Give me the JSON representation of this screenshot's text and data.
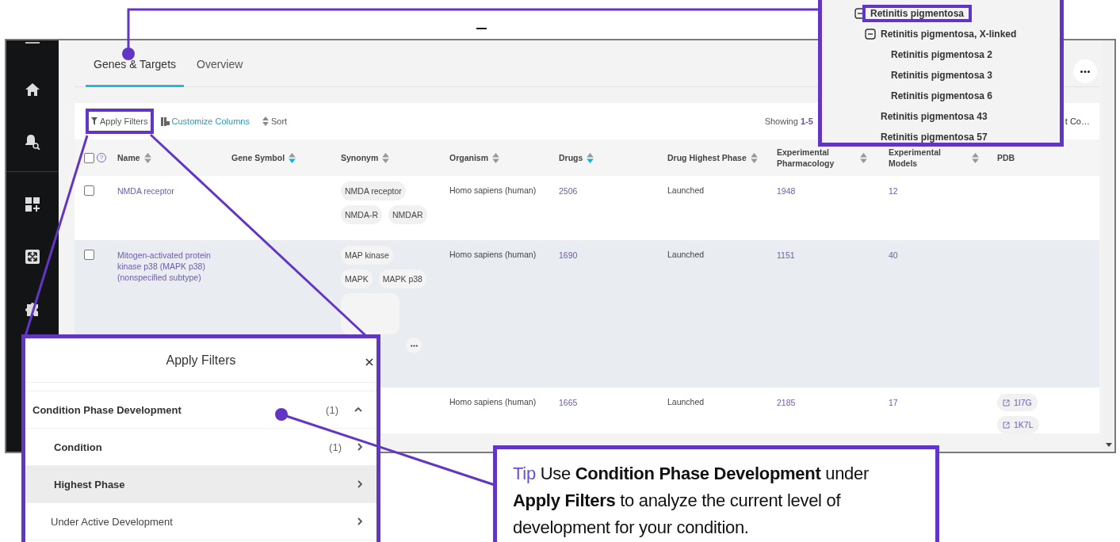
{
  "tabs": [
    {
      "label": "Genes & Targets",
      "selected": true
    },
    {
      "label": "Overview",
      "selected": false
    }
  ],
  "toolbar": {
    "buttons": [
      {
        "kind": "filter",
        "label": "Apply Filters",
        "highlighted": true
      },
      {
        "kind": "columns",
        "label": "Customize Columns",
        "highlighted": false
      },
      {
        "kind": "sort",
        "label": "Sort",
        "highlighted": false
      }
    ],
    "showing_label": "Showing",
    "showing_range": "1-5",
    "columns_button": "t Co…"
  },
  "table": {
    "all_checked": false,
    "help_mark": "?",
    "columns": [
      {
        "label": "Name",
        "sortable": true,
        "sorted": false
      },
      {
        "label": "Gene Symbol",
        "sortable": true,
        "sorted": true
      },
      {
        "label": "Synonym",
        "sortable": true,
        "sorted": false
      },
      {
        "label": "Organism",
        "sortable": true,
        "sorted": false
      },
      {
        "label": "Drugs",
        "sortable": true,
        "sorted": true
      },
      {
        "label": "Drug Highest Phase",
        "sortable": true,
        "sorted": false
      },
      {
        "label": "Experimental Pharmacology",
        "sortable": true,
        "sorted": false
      },
      {
        "label": "Experimental Models",
        "sortable": true,
        "sorted": false
      },
      {
        "label": "PDB"
      }
    ],
    "rows": [
      {
        "checked": false,
        "highlighted": false,
        "name": "NMDA receptor",
        "synonyms": [
          "NMDA receptor",
          "NMDA-R",
          "NMDAR"
        ],
        "organism": "Homo sapiens (human)",
        "drugs": "2506",
        "phase": "Launched",
        "pharmacology": "1948",
        "models": "12",
        "pdb": []
      },
      {
        "checked": false,
        "highlighted": true,
        "name": "Mitogen-activated protein kinase p38 (MAPK p38) (nonspecified subtype)",
        "synonyms": [
          "MAP kinase",
          "MAPK",
          "MAPK p38"
        ],
        "synonyms_more": true,
        "organism": "Homo sapiens (human)",
        "drugs": "1690",
        "phase": "Launched",
        "pharmacology": "1151",
        "models": "40",
        "pdb": []
      },
      {
        "highlighted": false,
        "synonyms": [],
        "organism": "Homo sapiens (human)",
        "drugs": "1665",
        "phase": "Launched",
        "pharmacology": "2185",
        "models": "17",
        "pdb": [
          "1I7G",
          "1K7L"
        ]
      }
    ]
  },
  "tree_callout": {
    "items": [
      {
        "label": "Retinitis pigmentosa",
        "highlighted": true,
        "expanded": true,
        "children": [
          {
            "label": "Retinitis pigmentosa, X-linked",
            "highlighted": false,
            "expanded": true,
            "children": [
              {
                "label": "Retinitis pigmentosa 2",
                "highlighted": false
              },
              {
                "label": "Retinitis pigmentosa 3",
                "highlighted": false
              },
              {
                "label": "Retinitis pigmentosa 6",
                "highlighted": false
              }
            ]
          },
          {
            "label": "Retinitis pigmentosa 43",
            "highlighted": false
          },
          {
            "label": "Retinitis pigmentosa 57",
            "highlighted": false
          }
        ]
      }
    ]
  },
  "filter_panel": {
    "title": "Apply Filters",
    "rows": [
      {
        "kind": "group",
        "label": "Condition Phase Development",
        "count": "(1)",
        "expanded": true,
        "highlighted": false
      },
      {
        "kind": "subgroup",
        "label": "Condition",
        "count": "(1)",
        "highlighted": false
      },
      {
        "kind": "subgroup",
        "label": "Highest Phase",
        "highlighted": true
      },
      {
        "kind": "option",
        "label": "Under Active Development",
        "highlighted": false
      }
    ]
  },
  "tip": {
    "label": "Tip",
    "text": "Use **Condition Phase Development** under **Apply Filters** to analyze the current level of development for your condition."
  }
}
